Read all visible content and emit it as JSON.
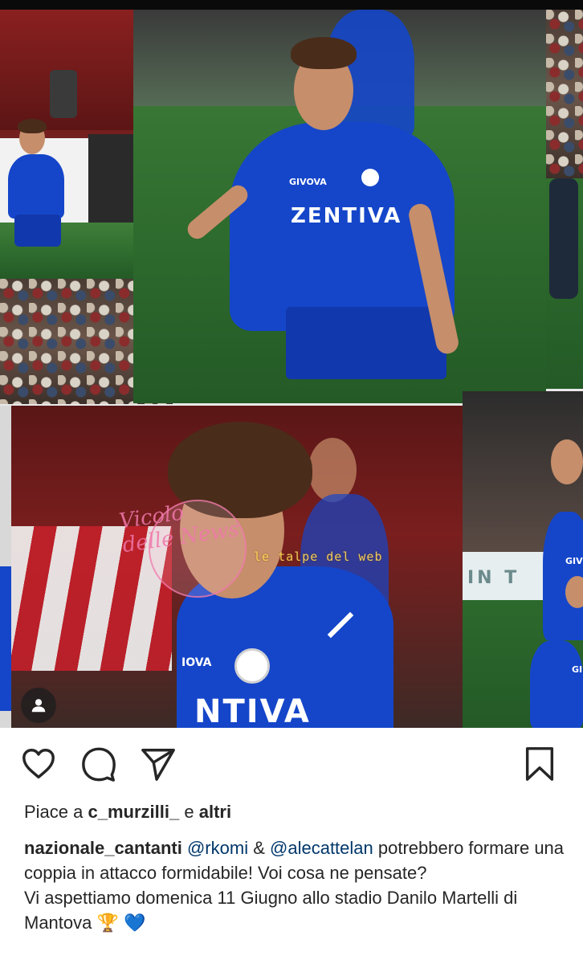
{
  "post": {
    "sponsor_text": "ZENTIVA",
    "sponsor_text_partial": "NTIVA",
    "kit_brand": "GIVOVA",
    "kit_brand_partial": "IOVA",
    "kit_brand_right": "GIV",
    "kit_brand_right2": "GI",
    "banner_text": "IN T",
    "watermark_script": "Vicolo delle News",
    "watermark_talpe": "le talpe del web"
  },
  "actions": {
    "like_icon": "heart-icon",
    "comment_icon": "comment-icon",
    "share_icon": "paper-plane-icon",
    "save_icon": "bookmark-icon",
    "user_tag_icon": "person-icon"
  },
  "likes": {
    "prefix": "Piace a",
    "user": "c_murzilli_",
    "middle": "e",
    "others": "altri"
  },
  "caption": {
    "author": "nazionale_cantanti",
    "mention1": "@rkomi",
    "amp": "&",
    "mention2": "@alecattelan",
    "text1": "potrebbero formare una coppia in attacco formidabile! Voi cosa ne pensate?",
    "text2": "Vi aspettiamo domenica 11 Giugno allo stadio Danilo Martelli di Mantova",
    "emojis": "🏆 💙"
  },
  "colors": {
    "kit_blue": "#1546c9",
    "mention_blue": "#00376b",
    "text": "#262626"
  }
}
